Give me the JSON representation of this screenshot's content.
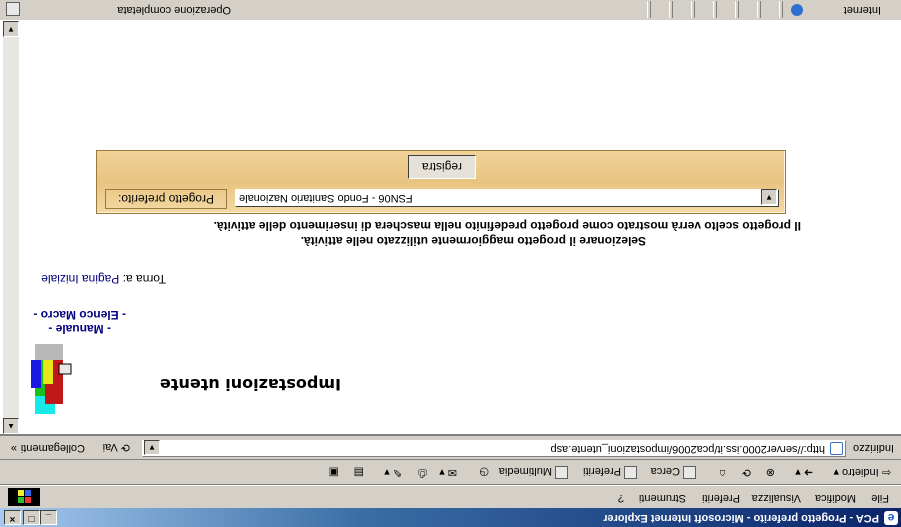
{
  "window": {
    "title": "PCA - Progetto preferito - Microsoft Internet Explorer",
    "minimize_label": "_",
    "maximize_label": "□",
    "close_label": "×"
  },
  "menu": {
    "items": [
      "File",
      "Modifica",
      "Visualizza",
      "Preferiti",
      "Strumenti",
      "?"
    ]
  },
  "toolbar": {
    "back_label": "Indietro",
    "search_label": "Cerca",
    "favorites_label": "Preferiti",
    "multimedia_label": "Multimedia"
  },
  "address": {
    "label": "Indirizzo",
    "url": "http://server2000.iss.it/pca2006/impostazioni_utente.asp",
    "go_label": "Vai",
    "links_label": "Collegamenti"
  },
  "page": {
    "title": "Impostazioni utente",
    "link_manuale": "- Manuale -",
    "link_elenco_macro": "- Elenco Macro -",
    "back_prefix": "Torna a:",
    "back_link": "Pagina Iniziale",
    "info_line1": "Selezionare il progetto maggiormente utilizzato nelle attività.",
    "info_line2": "Il progetto scelto verrà mostrato come progetto predefinito nella maschera di inserimento delle attività.",
    "project_label": "Progetto preferito:",
    "project_value": "FSN06 - Fondo Sanitario Nazionale",
    "save_button": "registra"
  },
  "status": {
    "text": "Operazione completata",
    "zone": "Internet"
  }
}
